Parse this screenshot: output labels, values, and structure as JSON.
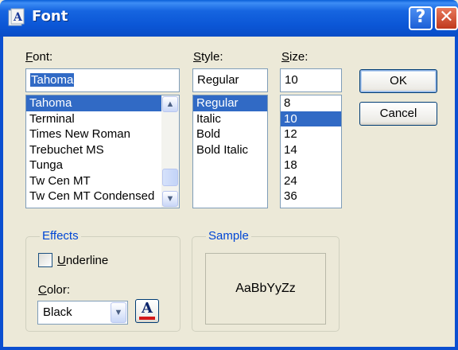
{
  "window": {
    "title": "Font",
    "help_label": "?",
    "close_label": "✕"
  },
  "font": {
    "label_accel": "F",
    "label_rest": "ont:",
    "value": "Tahoma",
    "items": [
      "Tahoma",
      "Terminal",
      "Times New Roman",
      "Trebuchet MS",
      "Tunga",
      "Tw Cen MT",
      "Tw Cen MT Condensed"
    ],
    "selected_index": 0
  },
  "style": {
    "label_accel": "S",
    "label_rest": "tyle:",
    "value": "Regular",
    "items": [
      "Regular",
      "Italic",
      "Bold",
      "Bold Italic"
    ],
    "selected_index": 0
  },
  "size": {
    "label_accel": "S",
    "label_rest": "ize:",
    "value": "10",
    "items": [
      "8",
      "10",
      "12",
      "14",
      "18",
      "24",
      "36"
    ],
    "selected_index": 1
  },
  "buttons": {
    "ok": "OK",
    "cancel": "Cancel"
  },
  "effects": {
    "title": "Effects",
    "underline_accel": "U",
    "underline_rest": "nderline",
    "underline_checked": false,
    "color_label_accel": "C",
    "color_label_rest": "olor:",
    "color_value": "Black",
    "color_button_letter": "A"
  },
  "sample": {
    "title": "Sample",
    "text": "AaBbYyZz"
  }
}
